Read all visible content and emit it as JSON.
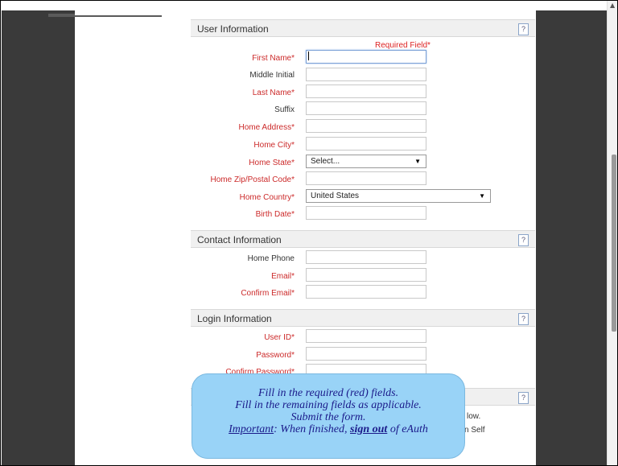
{
  "sections": {
    "user_info": {
      "title": "User Information",
      "help": "?"
    },
    "contact_info": {
      "title": "Contact Information",
      "help": "?"
    },
    "login_info": {
      "title": "Login Information",
      "help": "?"
    },
    "next_section": {
      "help": "?"
    }
  },
  "required_note": "Required Field*",
  "fields": {
    "first_name": {
      "label": "First Name*",
      "value": ""
    },
    "middle_initial": {
      "label": "Middle Initial",
      "value": ""
    },
    "last_name": {
      "label": "Last Name*",
      "value": ""
    },
    "suffix": {
      "label": "Suffix",
      "value": ""
    },
    "home_address": {
      "label": "Home Address*",
      "value": ""
    },
    "home_city": {
      "label": "Home City*",
      "value": ""
    },
    "home_state": {
      "label": "Home State*",
      "value": "Select..."
    },
    "home_zip": {
      "label": "Home Zip/Postal Code*",
      "value": ""
    },
    "home_country": {
      "label": "Home Country*",
      "value": "United States"
    },
    "birth_date": {
      "label": "Birth Date*",
      "value": ""
    },
    "home_phone": {
      "label": "Home Phone",
      "value": ""
    },
    "email": {
      "label": "Email*",
      "value": ""
    },
    "confirm_email": {
      "label": "Confirm Email*",
      "value": ""
    },
    "user_id": {
      "label": "User ID*",
      "value": ""
    },
    "password": {
      "label": "Password*",
      "value": ""
    },
    "confirm_password": {
      "label": "Confirm Password*",
      "value": ""
    }
  },
  "partial_text": {
    "a": "low.",
    "b": "n Self"
  },
  "tooltip": {
    "line1": "Fill in the required (red) fields.",
    "line2": "Fill in the remaining fields as applicable.",
    "line3": "Submit the form.",
    "important": "Important",
    "line4_mid": ": When finished, ",
    "sign_out": "sign out",
    "line4_end": " of eAuth"
  },
  "colors": {
    "required": "#cc2a2a",
    "tooltip_bg": "#99d3f7",
    "tooltip_text": "#1a1a8a"
  }
}
